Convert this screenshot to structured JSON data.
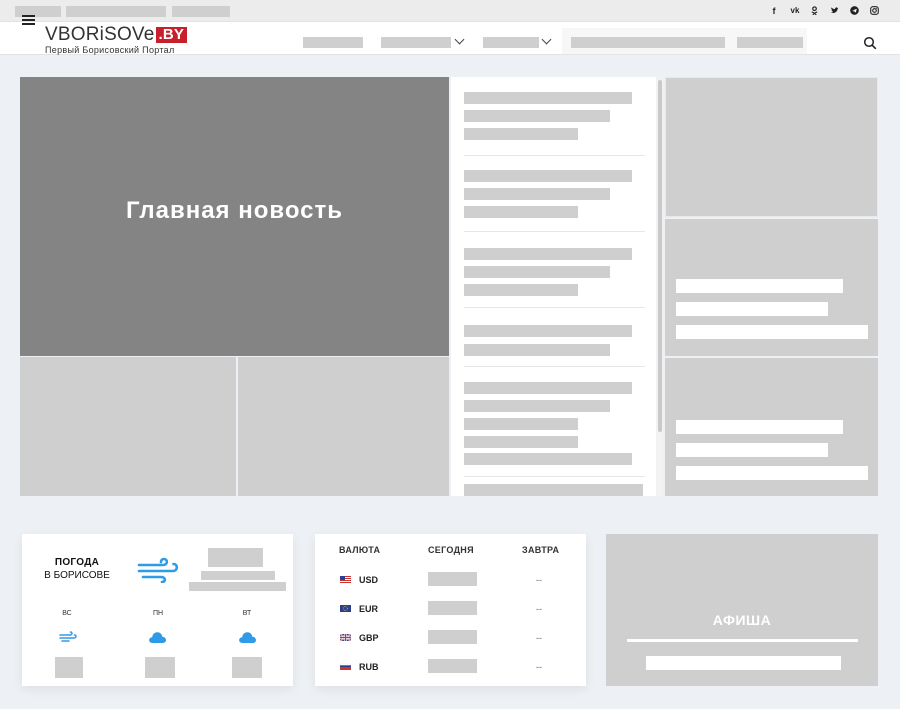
{
  "header": {
    "logo_main": "VBORiSOVe",
    "logo_suffix": ".BY",
    "logo_tagline": "Первый Борисовский Портал"
  },
  "social": [
    {
      "icon": "facebook-icon",
      "label": "f"
    },
    {
      "icon": "vk-icon",
      "label": "vk"
    },
    {
      "icon": "odnoklassniki-icon",
      "label": "ok"
    },
    {
      "icon": "twitter-icon",
      "label": "tw"
    },
    {
      "icon": "telegram-icon",
      "label": "tg"
    },
    {
      "icon": "instagram-icon",
      "label": "ig"
    }
  ],
  "hero": {
    "title": "Главная новость"
  },
  "weather": {
    "title": "ПОГОДА",
    "subtitle": "В БОРИСОВЕ",
    "days": [
      "ВС",
      "ПН",
      "ВТ"
    ]
  },
  "currency": {
    "headers": {
      "currency": "ВАЛЮТА",
      "today": "СЕГОДНЯ",
      "tomorrow": "ЗАВТРА"
    },
    "rows": [
      {
        "code": "USD",
        "tomorrow": "--"
      },
      {
        "code": "EUR",
        "tomorrow": "--"
      },
      {
        "code": "GBP",
        "tomorrow": "--"
      },
      {
        "code": "RUB",
        "tomorrow": "--"
      }
    ]
  },
  "afisha": {
    "title": "АФИША"
  },
  "colors": {
    "accent": "#c8202b",
    "placeholder": "#cfcfcf",
    "hero": "#848484",
    "weather_icon": "#2f9be8"
  }
}
